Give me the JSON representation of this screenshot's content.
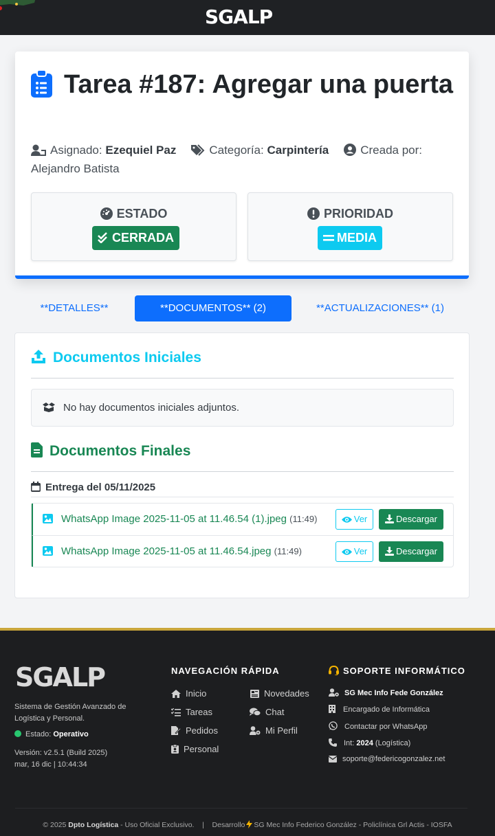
{
  "app": {
    "logo": "SGALP"
  },
  "task": {
    "title": "Tarea #187: Agregar una puerta",
    "assigned_label": "Asignado:",
    "assigned_value": "Ezequiel Paz",
    "category_label": "Categoría:",
    "category_value": "Carpintería",
    "created_label": "Creada por:",
    "created_value": "Alejandro Batista"
  },
  "status": {
    "estado_label": "ESTADO",
    "estado_value": "CERRADA",
    "prioridad_label": "PRIORIDAD",
    "prioridad_value": "MEDIA"
  },
  "tabs": [
    {
      "label": "**DETALLES**"
    },
    {
      "label": "**DOCUMENTOS** (2)"
    },
    {
      "label": "**ACTUALIZACIONES** (1)"
    }
  ],
  "docs": {
    "initial_title": "Documentos Iniciales",
    "initial_empty": "No hay documentos iniciales adjuntos.",
    "final_title": "Documentos Finales",
    "delivery": "Entrega del 05/11/2025",
    "files": [
      {
        "name": "WhatsApp Image 2025-11-05 at 11.46.54 (1).jpeg",
        "time": "(11:49)"
      },
      {
        "name": "WhatsApp Image 2025-11-05 at 11.46.54.jpeg",
        "time": "(11:49)"
      }
    ],
    "view_label": "Ver",
    "download_label": "Descargar"
  },
  "footer": {
    "logo": "SGALP",
    "description": "Sistema de Gestión Avanzado de Logística y Personal.",
    "state_label": "Estado:",
    "state_value": "Operativo",
    "version": "Versión: v2.5.1 (Build 2025)",
    "datetime": "mar, 16 dic | 10:44:34",
    "nav_title": "NAVEGACIÓN RÁPIDA",
    "nav": {
      "inicio": "Inicio",
      "novedades": "Novedades",
      "tareas": "Tareas",
      "chat": "Chat",
      "pedidos": "Pedidos",
      "perfil": "Mi Perfil",
      "personal": "Personal"
    },
    "support_title": "SOPORTE INFORMÁTICO",
    "support_name": "SG Mec Info Fede González",
    "support_role": "Encargado de Informática",
    "support_whatsapp": "Contactar por WhatsApp",
    "support_int_label": "Int:",
    "support_int_value": "2024",
    "support_int_suffix": "(Logística)",
    "support_email": "soporte@federicogonzalez.net",
    "copy_prefix": "© 2025",
    "copy_org": "Dpto Logística",
    "copy_rest": "- Uso Oficial Exclusivo.",
    "dev_prefix": "Desarrollo",
    "dev_rest": "SG Mec Info Federico González - Policlínica Grl Actis - IOSFA"
  },
  "colors": {
    "primary": "#0d6efd",
    "success": "#198754",
    "info": "#0dcaf0",
    "footer_bg": "#1d1e20",
    "footer_accent": "#c9a63b"
  }
}
